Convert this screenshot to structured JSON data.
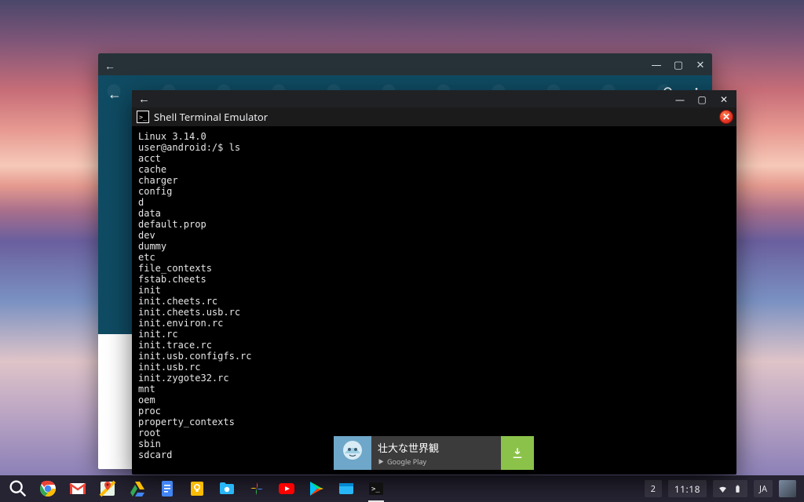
{
  "bg_window": {
    "back_glyph": "←",
    "minimize_glyph": "—",
    "maximize_glyph": "▢",
    "close_glyph": "✕",
    "header_back_glyph": "←",
    "search_label": "Search",
    "overflow_label": "More"
  },
  "terminal": {
    "titlebar": {
      "back_glyph": "←",
      "minimize_glyph": "—",
      "maximize_glyph": "▢",
      "close_glyph": "✕"
    },
    "app_icon_text": ">_",
    "app_title": "Shell Terminal Emulator",
    "close_red_glyph": "✕",
    "output": "Linux 3.14.0\nuser@android:/$ ls\nacct\ncache\ncharger\nconfig\nd\ndata\ndefault.prop\ndev\ndummy\netc\nfile_contexts\nfstab.cheets\ninit\ninit.cheets.rc\ninit.cheets.usb.rc\ninit.environ.rc\ninit.rc\ninit.trace.rc\ninit.usb.configfs.rc\ninit.usb.rc\ninit.zygote32.rc\nmnt\noem\nproc\nproperty_contexts\nroot\nsbin\nsdcard"
  },
  "ad": {
    "title": "壮大な世界観",
    "subtitle": "Google Play"
  },
  "shelf": {
    "icons": [
      {
        "name": "launcher-icon"
      },
      {
        "name": "chrome-icon"
      },
      {
        "name": "gmail-icon"
      },
      {
        "name": "google-maps-icon"
      },
      {
        "name": "google-drive-icon"
      },
      {
        "name": "google-docs-icon"
      },
      {
        "name": "google-keep-icon"
      },
      {
        "name": "files-icon"
      },
      {
        "name": "google-photos-icon"
      },
      {
        "name": "youtube-icon"
      },
      {
        "name": "google-play-icon"
      },
      {
        "name": "app-icon-1"
      },
      {
        "name": "terminal-app-icon",
        "active": true
      }
    ],
    "tray": {
      "notifications": "2",
      "clock": "11:18",
      "ime": "JA"
    }
  }
}
